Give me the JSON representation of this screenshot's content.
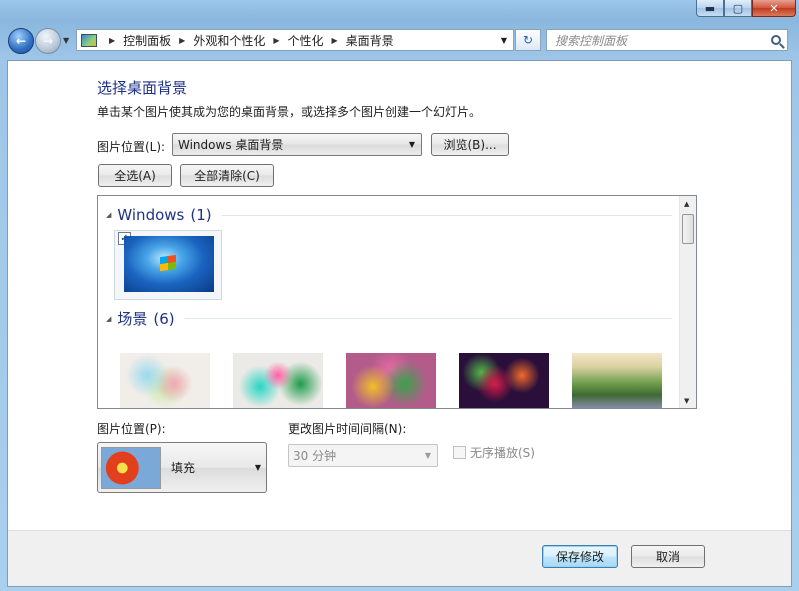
{
  "window": {
    "minimize_glyph": "▬",
    "maximize_glyph": "▢",
    "close_glyph": "✕"
  },
  "nav": {
    "back_glyph": "←",
    "forward_glyph": "→",
    "breadcrumb": [
      "控制面板",
      "外观和个性化",
      "个性化",
      "桌面背景"
    ],
    "search_placeholder": "搜索控制面板"
  },
  "page": {
    "title": "选择桌面背景",
    "description": "单击某个图片使其成为您的桌面背景，或选择多个图片创建一个幻灯片。",
    "location_label": "图片位置(L):",
    "location_value": "Windows 桌面背景",
    "browse_label": "浏览(B)...",
    "select_all_label": "全选(A)",
    "clear_all_label": "全部清除(C)"
  },
  "groups": [
    {
      "name": "Windows",
      "count": "(1)"
    },
    {
      "name": "场景",
      "count": "(6)"
    }
  ],
  "options": {
    "position_label": "图片位置(P):",
    "position_value": "填充",
    "interval_label": "更改图片时间间隔(N):",
    "interval_value": "30 分钟",
    "shuffle_label": "无序播放(S)",
    "shuffle_checked": false
  },
  "footer": {
    "save_label": "保存修改",
    "cancel_label": "取消"
  },
  "icons": {
    "check": "✓",
    "dropdown": "▼",
    "collapse": "◢",
    "scroll_up": "▲",
    "scroll_down": "▼",
    "refresh": "↻",
    "crumb_sep": "▶"
  },
  "colors": {
    "accent_title": "#1e3287",
    "window_glass": "#9ec6e8",
    "save_button_border": "#3c7fb1"
  }
}
